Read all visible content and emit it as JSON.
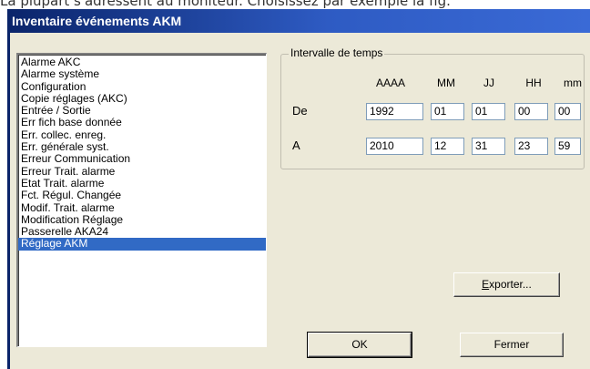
{
  "caption": "La plupart s'adressent au moniteur. Choisissez par exemple la fig.",
  "window": {
    "title": "Inventaire événements AKM"
  },
  "event_list": {
    "items": [
      "Alarme AKC",
      "Alarme système",
      "Configuration",
      "Copie réglages (AKC)",
      "Entrée / Sortie",
      "Err fich base donnée",
      "Err. collec. enreg.",
      "Err. générale syst.",
      "Erreur Communication",
      "Erreur Trait. alarme",
      "Etat Trait. alarme",
      "Fct. Régul. Changée",
      "Modif. Trait. alarme",
      "Modification Réglage",
      "Passerelle AKA24",
      "Réglage AKM"
    ],
    "selected": "Réglage AKM"
  },
  "time_range": {
    "legend": "Intervalle de temps",
    "headers": {
      "year": "AAAA",
      "month": "MM",
      "day": "JJ",
      "hour": "HH",
      "minute": "mm"
    },
    "from": {
      "label": "De",
      "year": "1992",
      "month": "01",
      "day": "01",
      "hour": "00",
      "minute": "00"
    },
    "to": {
      "label": "A",
      "year": "2010",
      "month": "12",
      "day": "31",
      "hour": "23",
      "minute": "59"
    }
  },
  "buttons": {
    "export_prefix": "",
    "export_mnemonic": "E",
    "export_rest": "xporter...",
    "ok": "OK",
    "close": "Fermer"
  },
  "colors": {
    "titlebar": "#0a246a",
    "dialog_face": "#ece9d8",
    "selection": "#316ac5"
  }
}
